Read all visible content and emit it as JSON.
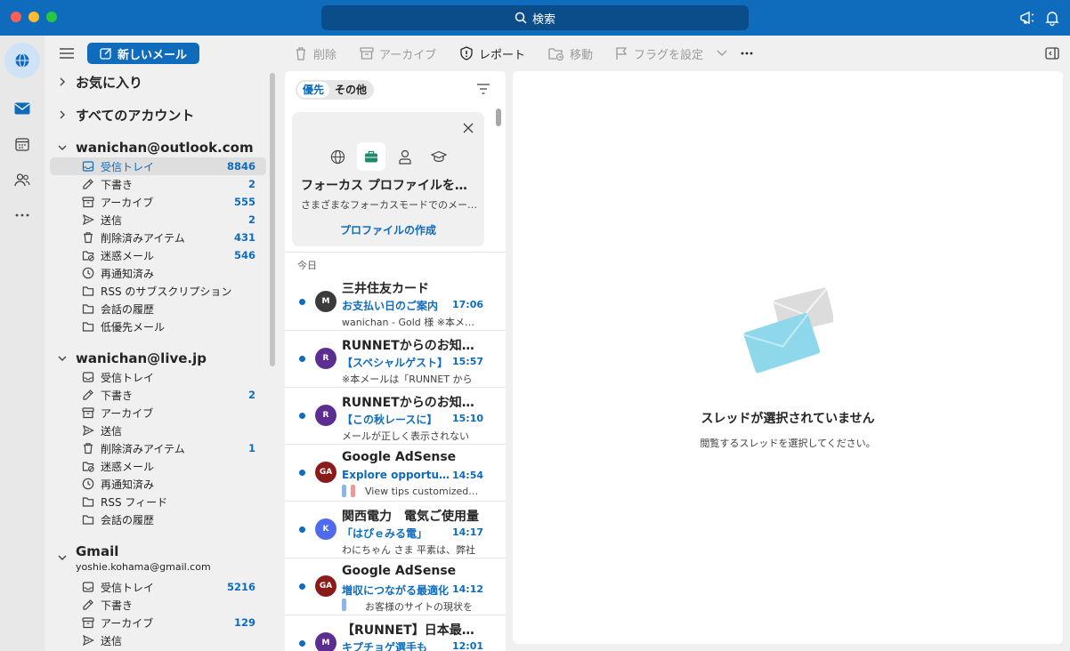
{
  "titlebar": {
    "search_label": "検索",
    "icons": [
      "search-icon",
      "megaphone-icon",
      "bell-icon"
    ]
  },
  "rail": {
    "items": [
      {
        "name": "globe-icon",
        "active": true
      },
      {
        "name": "mail-icon",
        "active": false
      },
      {
        "name": "calendar-icon",
        "active": false
      },
      {
        "name": "people-icon",
        "active": false
      },
      {
        "name": "more-icon",
        "active": false
      }
    ]
  },
  "folder_pane": {
    "new_mail_label": "新しいメール",
    "favorites_label": "お気に入り",
    "all_accounts_label": "すべてのアカウント",
    "accounts": [
      {
        "name": "wanichan@outlook.com",
        "folders": [
          {
            "label": "受信トレイ",
            "count": "8846",
            "icon": "inbox-icon",
            "selected": true
          },
          {
            "label": "下書き",
            "count": "2",
            "icon": "draft-icon"
          },
          {
            "label": "アーカイブ",
            "count": "555",
            "icon": "archive-icon"
          },
          {
            "label": "送信",
            "count": "2",
            "icon": "send-icon"
          },
          {
            "label": "削除済みアイテム",
            "count": "431",
            "icon": "trash-icon"
          },
          {
            "label": "迷惑メール",
            "count": "546",
            "icon": "junk-icon"
          },
          {
            "label": "再通知済み",
            "count": "",
            "icon": "clock-icon"
          },
          {
            "label": "RSS のサブスクリプション",
            "count": "",
            "icon": "folder-icon"
          },
          {
            "label": "会話の履歴",
            "count": "",
            "icon": "folder-icon"
          },
          {
            "label": "低優先メール",
            "count": "",
            "icon": "folder-icon"
          }
        ]
      },
      {
        "name": "wanichan@live.jp",
        "folders": [
          {
            "label": "受信トレイ",
            "count": "",
            "icon": "inbox-icon"
          },
          {
            "label": "下書き",
            "count": "2",
            "icon": "draft-icon"
          },
          {
            "label": "アーカイブ",
            "count": "",
            "icon": "archive-icon"
          },
          {
            "label": "送信",
            "count": "",
            "icon": "send-icon"
          },
          {
            "label": "削除済みアイテム",
            "count": "1",
            "icon": "trash-icon"
          },
          {
            "label": "迷惑メール",
            "count": "",
            "icon": "junk-icon"
          },
          {
            "label": "再通知済み",
            "count": "",
            "icon": "clock-icon"
          },
          {
            "label": "RSS フィード",
            "count": "",
            "icon": "folder-icon"
          },
          {
            "label": "会話の履歴",
            "count": "",
            "icon": "folder-icon"
          }
        ]
      },
      {
        "name": "Gmail",
        "email": "yoshie.kohama@gmail.com",
        "folders": [
          {
            "label": "受信トレイ",
            "count": "5216",
            "icon": "inbox-icon"
          },
          {
            "label": "下書き",
            "count": "",
            "icon": "draft-icon"
          },
          {
            "label": "アーカイブ",
            "count": "129",
            "icon": "archive-icon"
          },
          {
            "label": "送信",
            "count": "",
            "icon": "send-icon"
          }
        ]
      }
    ]
  },
  "toolbar": {
    "delete_label": "削除",
    "archive_label": "アーカイブ",
    "report_label": "レポート",
    "move_label": "移動",
    "flag_label": "フラグを設定"
  },
  "message_list": {
    "tab_focused": "優先",
    "tab_other": "その他",
    "focus_card": {
      "title": "フォーカス プロファイルを設定",
      "description": "さまざまなフォーカスモードでのメールの表示",
      "link": "プロファイルの作成"
    },
    "day_label": "今日",
    "messages": [
      {
        "initials": "M",
        "avatar_color": "#3b3b3b",
        "sender": "三井住友カード",
        "subject": "お支払い日のご案内",
        "time": "17:06",
        "preview": "wanichan - Gold 様 ※本メールは",
        "tags": []
      },
      {
        "initials": "R",
        "avatar_color": "#5c2e91",
        "sender": "RUNNETからのお知らせ",
        "subject": "【スペシャルゲスト】",
        "time": "15:57",
        "preview": "※本メールは「RUNNET から",
        "tags": []
      },
      {
        "initials": "R",
        "avatar_color": "#5c2e91",
        "sender": "RUNNETからのお知らせ",
        "subject": "【この秋レースに】",
        "time": "15:10",
        "preview": "メールが正しく表示されない",
        "tags": []
      },
      {
        "initials": "GA",
        "avatar_color": "#8b1a1a",
        "sender": "Google AdSense",
        "subject": "Explore opportunities",
        "time": "14:54",
        "preview": "View tips customized for you",
        "tags": [
          "#8fb4e8",
          "#e89a9a"
        ]
      },
      {
        "initials": "K",
        "avatar_color": "#4f6bed",
        "sender": "関西電力　電気ご使用量",
        "subject": "「はぴｅみる電」",
        "time": "14:17",
        "preview": "わにちゃん さま 平素は、弊社",
        "tags": []
      },
      {
        "initials": "GA",
        "avatar_color": "#8b1a1a",
        "sender": "Google AdSense",
        "subject": "増収につながる最適化",
        "time": "14:12",
        "preview": "お客様のサイトの現状を",
        "tags": [
          "#8fb4e8"
        ]
      },
      {
        "initials": "M",
        "avatar_color": "#5c2e91",
        "sender": "【RUNNET】日本最大級",
        "subject": "キプチョゲ選手も",
        "time": "12:01",
        "preview": "",
        "tags": []
      }
    ]
  },
  "reading_pane": {
    "empty_title": "スレッドが選択されていません",
    "empty_description": "閲覧するスレッドを選択してください。"
  },
  "colors": {
    "accent": "#0f6cbd",
    "unread_dot": "#0f6cbd"
  }
}
